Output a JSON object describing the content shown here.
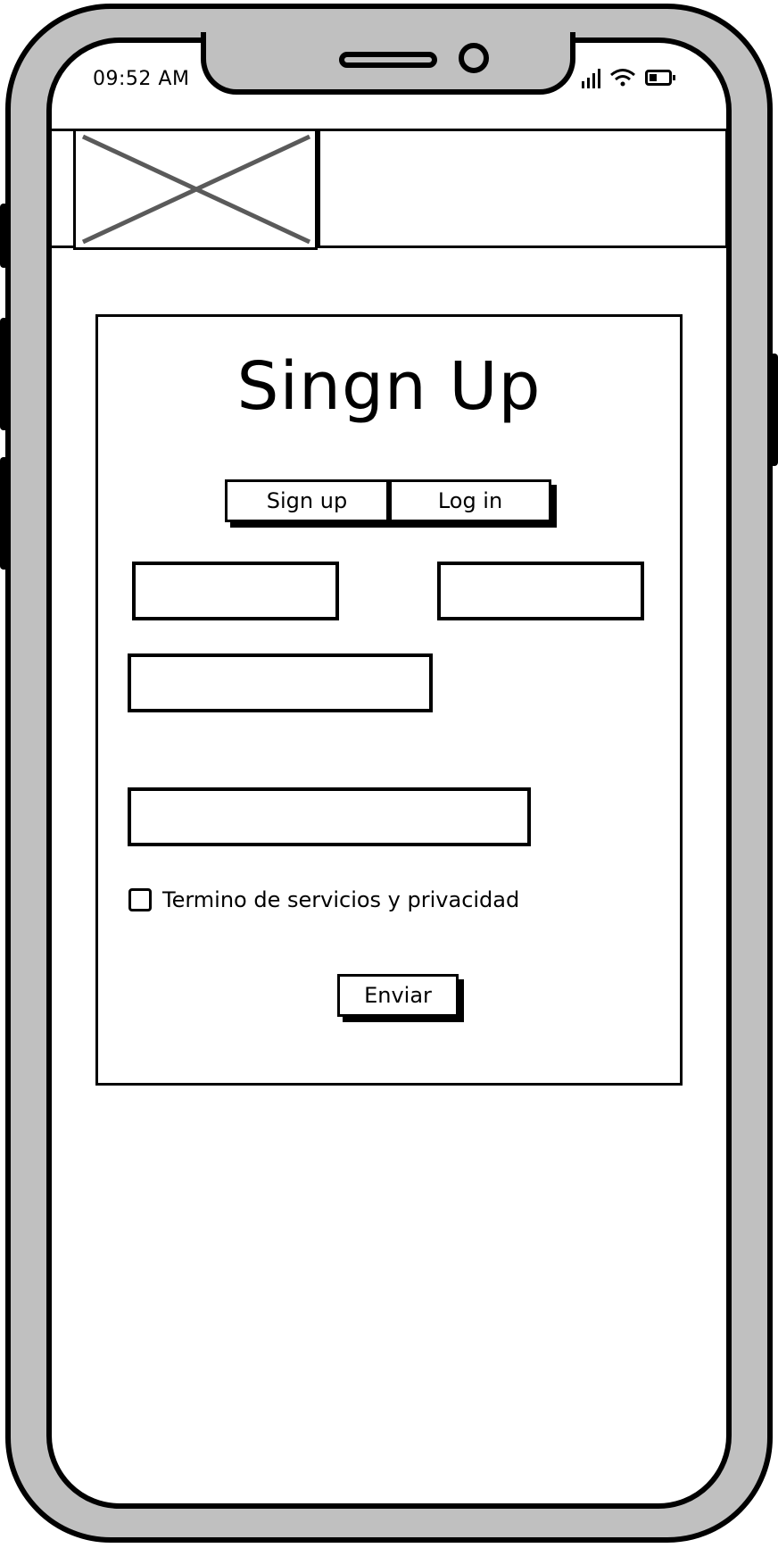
{
  "status_bar": {
    "time": "09:52 AM",
    "icons": [
      "signal-icon",
      "wifi-icon",
      "battery-icon"
    ]
  },
  "header": {
    "logo_placeholder": "image-placeholder-icon"
  },
  "form": {
    "title": "Singn Up",
    "tabs": [
      {
        "label": "Sign up"
      },
      {
        "label": "Log in"
      }
    ],
    "fields": [
      {
        "value": "",
        "placeholder": ""
      },
      {
        "value": "",
        "placeholder": ""
      },
      {
        "value": "",
        "placeholder": ""
      },
      {
        "value": "",
        "placeholder": ""
      }
    ],
    "terms_label": "Termino de servicios y privacidad",
    "terms_checked": false,
    "submit_label": "Enviar"
  },
  "colors": {
    "frame": "#c0c0c0",
    "ink": "#000000",
    "placeholder_cross": "#5a5a5a",
    "background": "#ffffff"
  }
}
